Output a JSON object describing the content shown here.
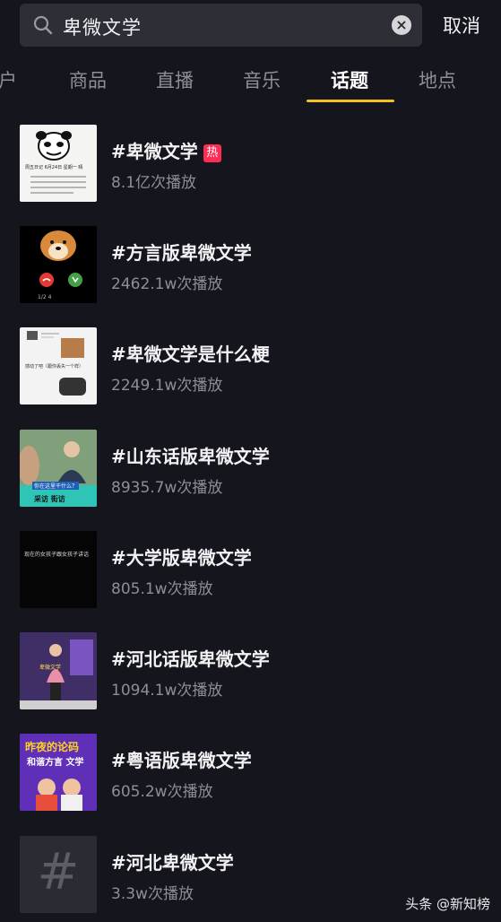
{
  "search": {
    "query": "卑微文学",
    "clear_icon": "clear-icon",
    "cancel_label": "取消"
  },
  "tabs": [
    {
      "label": "户",
      "active": false
    },
    {
      "label": "商品",
      "active": false
    },
    {
      "label": "直播",
      "active": false
    },
    {
      "label": "音乐",
      "active": false
    },
    {
      "label": "话题",
      "active": true
    },
    {
      "label": "地点",
      "active": false
    }
  ],
  "accent_color": "#f3c11e",
  "hot_badge_color": "#fe2c55",
  "topics": [
    {
      "title": "#卑微文学",
      "plays": "8.1亿次播放",
      "hot": "热",
      "thumb": {
        "text": "周五日记  6月24日  星期一  晴"
      }
    },
    {
      "title": "#方言版卑微文学",
      "plays": "2462.1w次播放",
      "thumb": {
        "text": "1/2 4"
      }
    },
    {
      "title": "#卑微文学是什么梗",
      "plays": "2249.1w次播放",
      "thumb": {
        "text": "感动了吧（跟你丢失一个样）"
      }
    },
    {
      "title": "#山东话版卑微文学",
      "plays": "8935.7w次播放",
      "thumb": {
        "text": "你在这里干什么？",
        "tag": "采访  街访"
      }
    },
    {
      "title": "#大学版卑微文学",
      "plays": "805.1w次播放",
      "thumb": {
        "text": "现在的女孩子跟女孩子讲话"
      }
    },
    {
      "title": "#河北话版卑微文学",
      "plays": "1094.1w次播放",
      "thumb": {
        "text": "卑微文学"
      }
    },
    {
      "title": "#粤语版卑微文学",
      "plays": "605.2w次播放",
      "thumb": {
        "text": "昨夜的论码",
        "sub": "和谐方言 文学"
      }
    },
    {
      "title": "#河北卑微文学",
      "plays": "3.3w次播放",
      "thumb": {
        "text": "#"
      }
    }
  ],
  "watermark": "头条 @新知榜"
}
